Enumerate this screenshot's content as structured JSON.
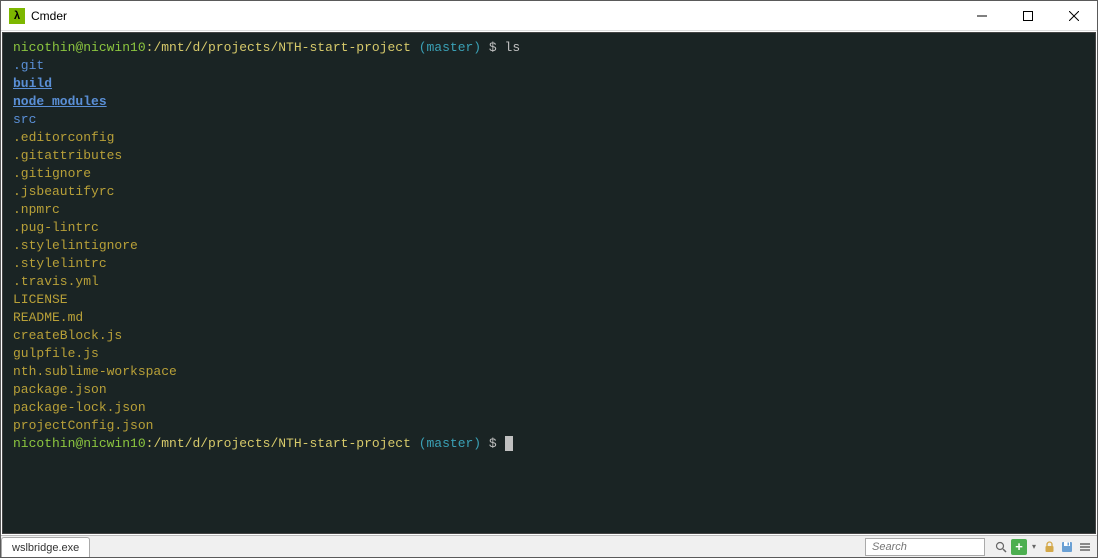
{
  "window": {
    "title": "Cmder",
    "icon_char": "λ"
  },
  "terminal": {
    "prompt1": {
      "user": "nicothin@nicwin10",
      "colon": ":",
      "path": "/mnt/d/projects/NTH-start-project",
      "branch": " (master)",
      "dollar": " $ ",
      "cmd": "ls"
    },
    "ls_output": [
      {
        "text": ".git",
        "cls": "dir"
      },
      {
        "text": "build",
        "cls": "dir-bold"
      },
      {
        "text": "node_modules",
        "cls": "dir-bold"
      },
      {
        "text": "src",
        "cls": "dir"
      },
      {
        "text": ".editorconfig",
        "cls": "file-y"
      },
      {
        "text": ".gitattributes",
        "cls": "file-y"
      },
      {
        "text": ".gitignore",
        "cls": "file-y"
      },
      {
        "text": ".jsbeautifyrc",
        "cls": "file-y"
      },
      {
        "text": ".npmrc",
        "cls": "file-y"
      },
      {
        "text": ".pug-lintrc",
        "cls": "file-y"
      },
      {
        "text": ".stylelintignore",
        "cls": "file-y"
      },
      {
        "text": ".stylelintrc",
        "cls": "file-y"
      },
      {
        "text": ".travis.yml",
        "cls": "file-y"
      },
      {
        "text": "LICENSE",
        "cls": "file-y"
      },
      {
        "text": "README.md",
        "cls": "file-y"
      },
      {
        "text": "createBlock.js",
        "cls": "file-y"
      },
      {
        "text": "gulpfile.js",
        "cls": "file-y"
      },
      {
        "text": "nth.sublime-workspace",
        "cls": "file-special"
      },
      {
        "text": "package.json",
        "cls": "file-y"
      },
      {
        "text": "package-lock.json",
        "cls": "file-y"
      },
      {
        "text": "projectConfig.json",
        "cls": "file-y"
      }
    ],
    "prompt2": {
      "user": "nicothin@nicwin10",
      "colon": ":",
      "path": "/mnt/d/projects/NTH-start-project",
      "branch": " (master)",
      "dollar": " $ "
    }
  },
  "statusbar": {
    "tab": "wslbridge.exe",
    "search_placeholder": "Search"
  }
}
